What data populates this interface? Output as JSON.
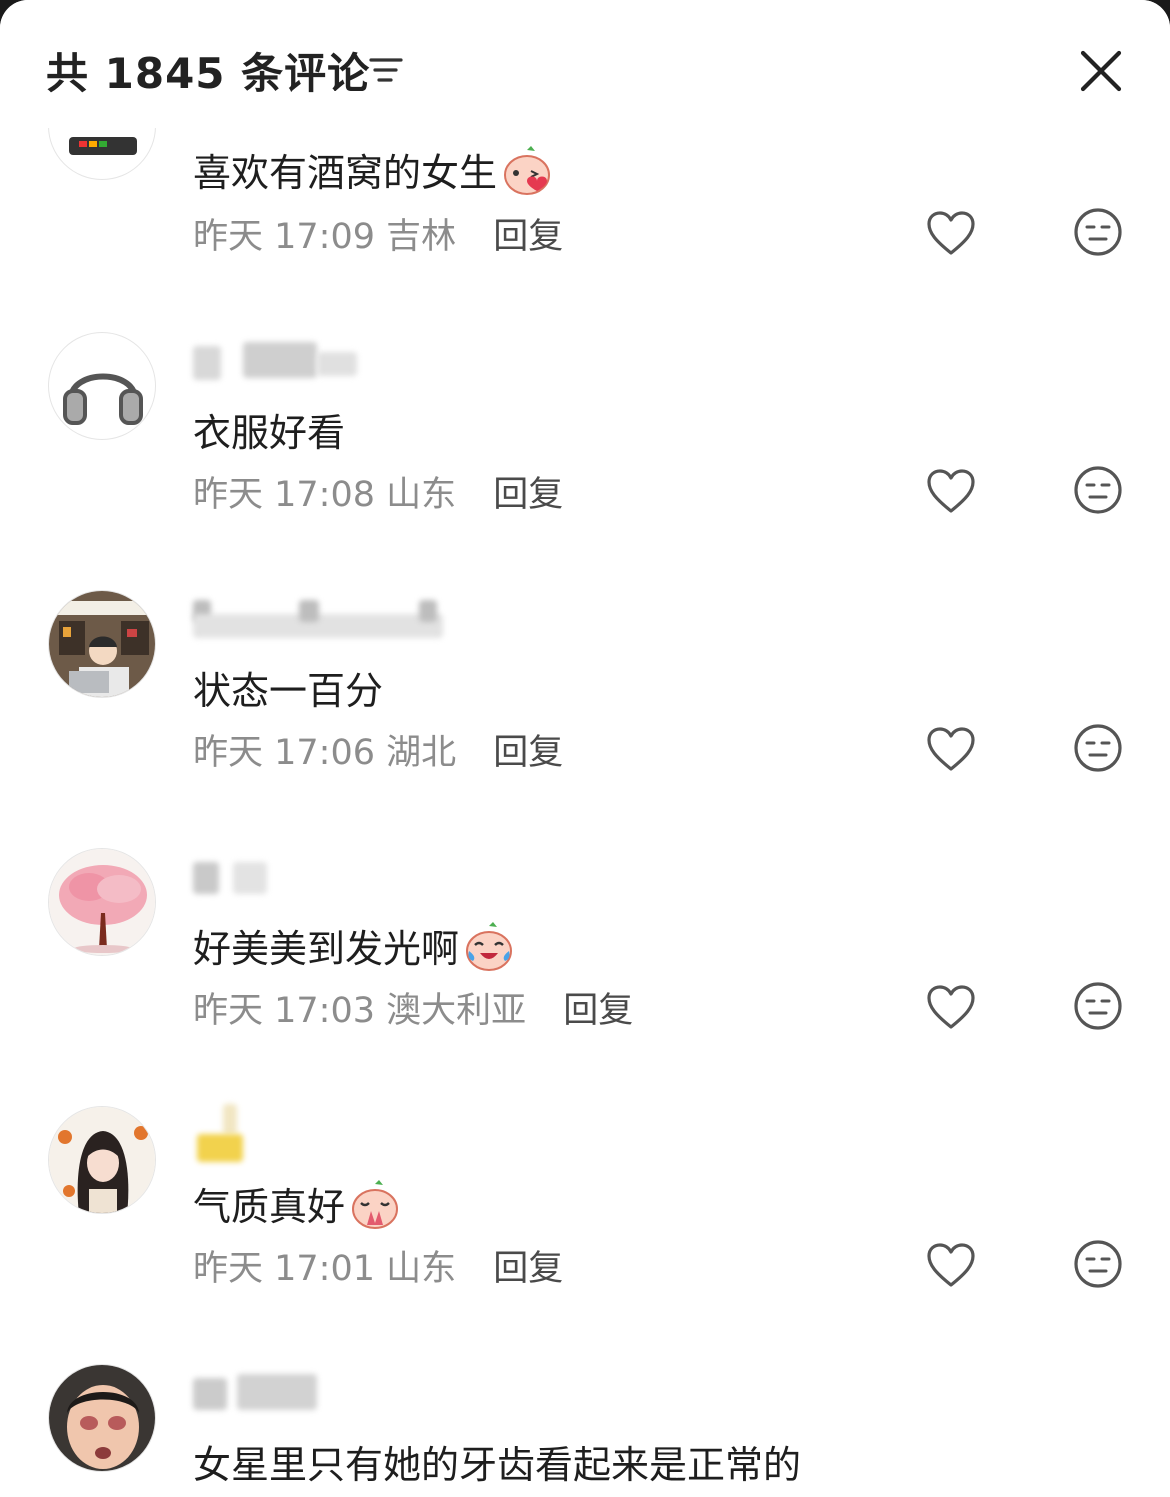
{
  "header": {
    "title": "共 1845 条评论",
    "sort_icon": "filter-lines-icon",
    "close_icon": "close-icon"
  },
  "comments": [
    {
      "username": "",
      "text": "喜欢有酒窝的女生",
      "emoji": "peach-kiss-emoji",
      "time": "昨天 17:09",
      "location": "吉林",
      "reply_label": "回复"
    },
    {
      "username": "",
      "text": "衣服好看",
      "time": "昨天 17:08",
      "location": "山东",
      "reply_label": "回复"
    },
    {
      "username": "",
      "text": "状态一百分",
      "time": "昨天 17:06",
      "location": "湖北",
      "reply_label": "回复"
    },
    {
      "username": "",
      "text": "好美美到发光啊",
      "emoji": "peach-laugh-cry-emoji",
      "time": "昨天 17:03",
      "location": "澳大利亚",
      "reply_label": "回复"
    },
    {
      "username": "",
      "text": "气质真好",
      "emoji": "peach-pray-emoji",
      "time": "昨天 17:01",
      "location": "山东",
      "reply_label": "回复"
    },
    {
      "username": "",
      "text": "女星里只有她的牙齿看起来是正常的"
    }
  ],
  "colors": {
    "text_primary": "#1e1e1e",
    "text_meta": "#8c8c8c",
    "reply": "#4a4a4a",
    "icon": "#555555"
  }
}
